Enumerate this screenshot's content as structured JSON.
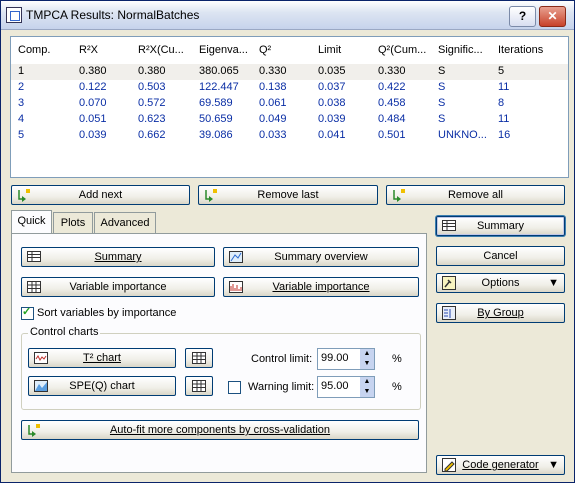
{
  "window": {
    "title": "TMPCA Results: NormalBatches",
    "help_label": "?",
    "close_label": "✕"
  },
  "table": {
    "columns": [
      "Comp.",
      "R²X",
      "R²X(Cu...",
      "Eigenva...",
      "Q²",
      "Limit",
      "Q²(Cum...",
      "Signific...",
      "Iterations"
    ],
    "rows": [
      [
        "1",
        "0.380",
        "0.380",
        "380.065",
        "0.330",
        "0.035",
        "0.330",
        "S",
        "5"
      ],
      [
        "2",
        "0.122",
        "0.503",
        "122.447",
        "0.138",
        "0.037",
        "0.422",
        "S",
        "11"
      ],
      [
        "3",
        "0.070",
        "0.572",
        "69.589",
        "0.061",
        "0.038",
        "0.458",
        "S",
        "8"
      ],
      [
        "4",
        "0.051",
        "0.623",
        "50.659",
        "0.049",
        "0.039",
        "0.484",
        "S",
        "11"
      ],
      [
        "5",
        "0.039",
        "0.662",
        "39.086",
        "0.033",
        "0.041",
        "0.501",
        "UNKNO...",
        "16"
      ]
    ]
  },
  "row_buttons": {
    "add_next": "Add next",
    "remove_last": "Remove last",
    "remove_all": "Remove all"
  },
  "tabs": [
    "Quick",
    "Plots",
    "Advanced"
  ],
  "quick": {
    "summary": "Summary",
    "summary_overview": "Summary overview",
    "variable_importance_1": "Variable importance",
    "variable_importance_2": "Variable importance",
    "sort_label": "Sort variables by importance",
    "group_label": "Control charts",
    "t2_chart": "T² chart",
    "spe_chart": "SPE(Q) chart",
    "control_limit_label": "Control limit:",
    "control_limit_value": "99.00",
    "warning_limit_label": "Warning limit:",
    "warning_limit_value": "95.00",
    "percent": "%",
    "autofit": "Auto-fit more components by cross-validation"
  },
  "side": {
    "summary": "Summary",
    "cancel": "Cancel",
    "options": "Options",
    "by_group": "By Group",
    "code_generator": "Code generator"
  }
}
